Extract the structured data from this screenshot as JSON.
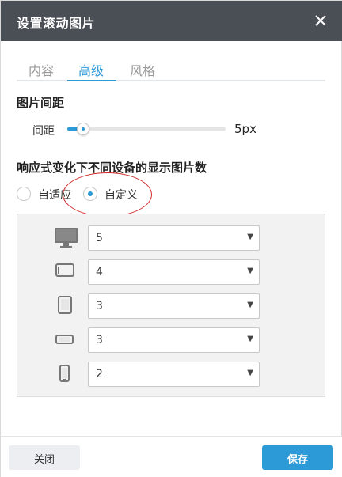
{
  "dialog": {
    "title": "设置滚动图片",
    "close_icon": "close-icon"
  },
  "tabs": [
    {
      "label": "内容",
      "active": false
    },
    {
      "label": "高级",
      "active": true
    },
    {
      "label": "风格",
      "active": false
    }
  ],
  "spacing_section": {
    "title": "图片间距",
    "label": "间距",
    "value_text": "5px",
    "slider_fraction": 0.1
  },
  "responsive_section": {
    "title": "响应式变化下不同设备的显示图片数",
    "options": [
      {
        "label": "自适应",
        "checked": false
      },
      {
        "label": "自定义",
        "checked": true
      }
    ]
  },
  "devices": [
    {
      "icon": "desktop-monitor-icon",
      "value": "5"
    },
    {
      "icon": "tablet-landscape-icon",
      "value": "4"
    },
    {
      "icon": "tablet-portrait-icon",
      "value": "3"
    },
    {
      "icon": "phone-landscape-icon",
      "value": "3"
    },
    {
      "icon": "phone-portrait-icon",
      "value": "2"
    }
  ],
  "footer": {
    "close_label": "关闭",
    "save_label": "保存"
  },
  "colors": {
    "accent": "#2d9ad8",
    "titlebar": "#4a4e55",
    "annotation": "#d02b2b"
  }
}
